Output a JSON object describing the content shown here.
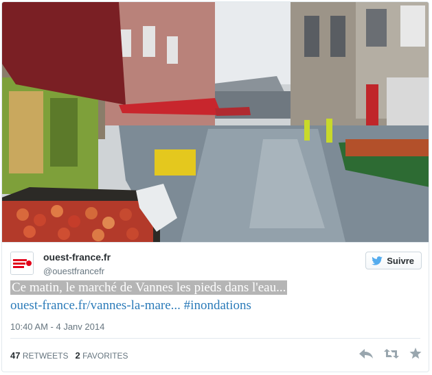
{
  "user": {
    "display_name": "ouest-france.fr",
    "screen_name": "@ouestfrancefr",
    "avatar_text": "ouest-france"
  },
  "follow_button": {
    "label": "Suivre"
  },
  "tweet": {
    "text": "Ce matin, le marché de Vannes les pieds dans l'eau...",
    "link": "ouest-france.fr/vannes-la-mare...",
    "hashtag": "#inondations",
    "timestamp": "10:40 AM - 4 Janv 2014"
  },
  "stats": {
    "retweets_count": "47",
    "retweets_label": "RETWEETS",
    "favorites_count": "2",
    "favorites_label": "FAVORITES"
  },
  "icons": {
    "bird": "twitter-bird-icon",
    "reply": "reply-icon",
    "retweet": "retweet-icon",
    "favorite": "star-icon"
  },
  "colors": {
    "link": "#2b7bb9",
    "bird": "#55acee",
    "avatar_red": "#e2001a"
  }
}
